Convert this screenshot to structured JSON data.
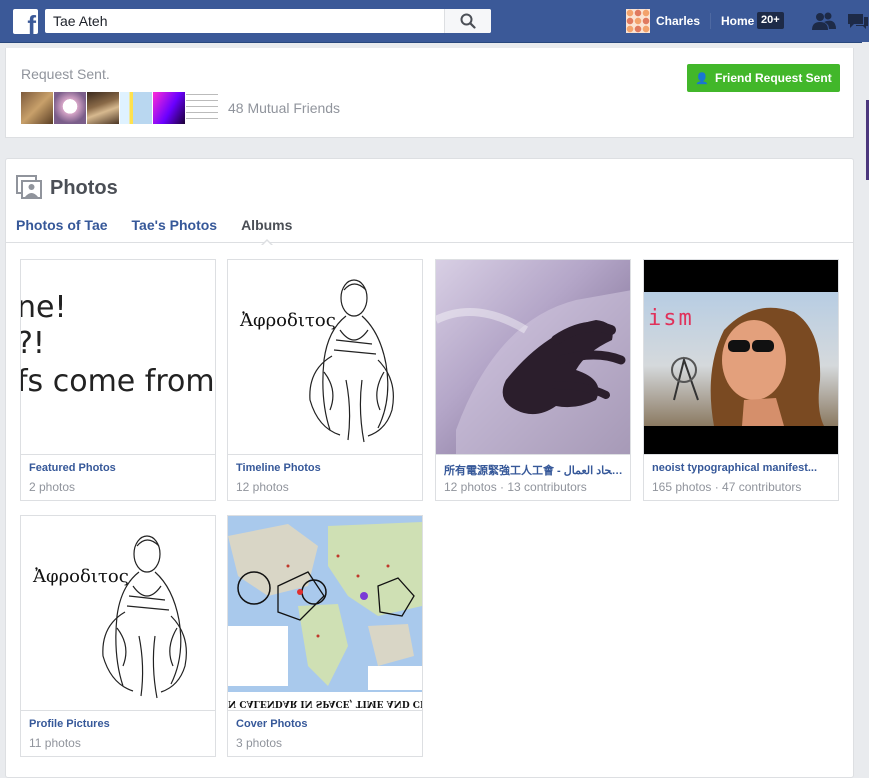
{
  "topbar": {
    "search_value": "Tae Ateh",
    "user_name": "Charles",
    "home_label": "Home",
    "home_badge": "20+",
    "brand_color": "#3b5998",
    "icons": [
      "facebook-logo-icon",
      "search-icon",
      "friends-icon",
      "messages-icon"
    ]
  },
  "request": {
    "status": "Request Sent.",
    "mutual_friends": "48 Mutual Friends",
    "button_label": "Friend Request Sent",
    "button_color": "#42b72a"
  },
  "photos": {
    "title": "Photos",
    "tabs": [
      "Photos of Tae",
      "Tae's Photos",
      "Albums"
    ],
    "active_tab": "Albums",
    "albums": [
      {
        "name": "Featured Photos",
        "meta": "2 photos",
        "cover_lines": [
          "ne!",
          "?!",
          "fs come from"
        ]
      },
      {
        "name": "Timeline Photos",
        "meta": "12 photos",
        "cover_text": "Ἀφροδιτος"
      },
      {
        "name": "所有電源緊強工人工會 - اتحاد العمال ...",
        "meta": "12 photos · 13 contributors"
      },
      {
        "name": "neoist typographical manifest...",
        "meta": "165 photos · 47 contributors",
        "cover_text": "ism"
      },
      {
        "name": "Profile Pictures",
        "meta": "11 photos",
        "cover_text": "Ἀφροδιτος"
      },
      {
        "name": "Cover Photos",
        "meta": "3 photos",
        "cover_text": "N CALENDAR IN SPACE, TIME AND CLASS I"
      }
    ]
  }
}
